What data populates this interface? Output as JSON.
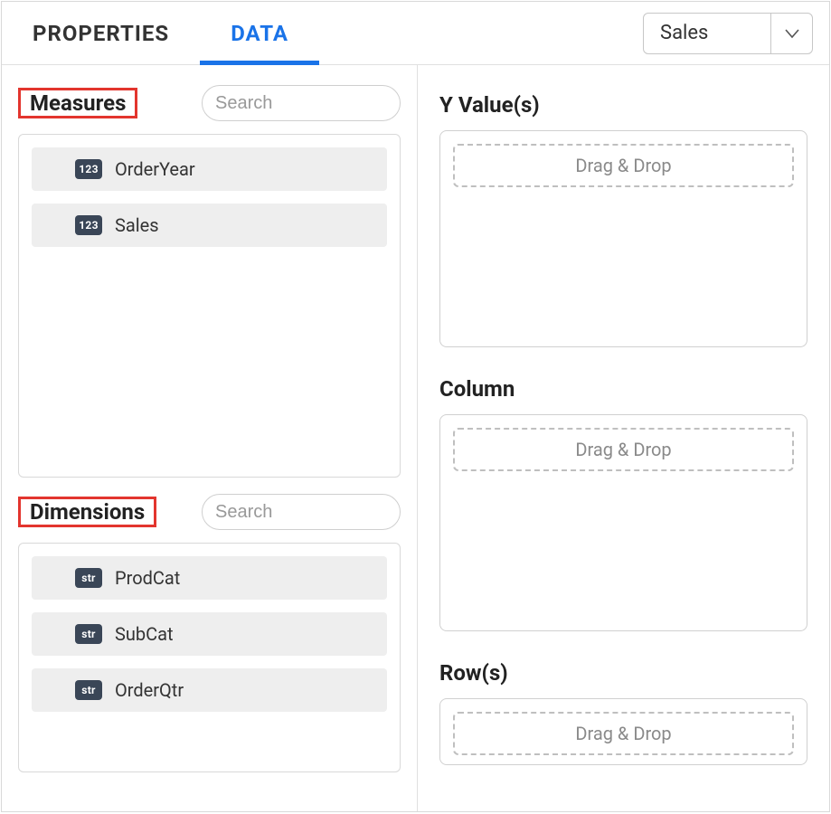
{
  "tabs": {
    "properties": "PROPERTIES",
    "data": "DATA"
  },
  "dataset_selector": {
    "value": "Sales"
  },
  "measures": {
    "title": "Measures",
    "search_placeholder": "Search",
    "items": [
      {
        "badge": "123",
        "label": "OrderYear"
      },
      {
        "badge": "123",
        "label": "Sales"
      }
    ]
  },
  "dimensions": {
    "title": "Dimensions",
    "search_placeholder": "Search",
    "items": [
      {
        "badge": "str",
        "label": "ProdCat"
      },
      {
        "badge": "str",
        "label": "SubCat"
      },
      {
        "badge": "str",
        "label": "OrderQtr"
      }
    ]
  },
  "dropzones": {
    "y": {
      "title": "Y Value(s)",
      "placeholder": "Drag & Drop"
    },
    "column": {
      "title": "Column",
      "placeholder": "Drag & Drop"
    },
    "rows": {
      "title": "Row(s)",
      "placeholder": "Drag & Drop"
    }
  }
}
